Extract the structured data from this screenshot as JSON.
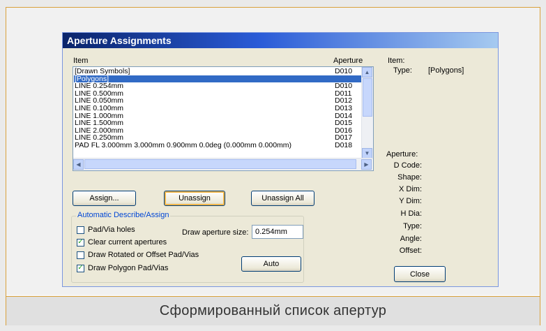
{
  "caption": "Сформированный список апертур",
  "dialog": {
    "title": "Aperture Assignments",
    "list": {
      "col_item": "Item",
      "col_aperture": "Aperture",
      "rows": [
        {
          "item": "[Drawn Symbols]",
          "aperture": "D010",
          "selected": false
        },
        {
          "item": "[Polygons]",
          "aperture": "",
          "selected": true
        },
        {
          "item": "LINE 0.254mm",
          "aperture": "D010",
          "selected": false
        },
        {
          "item": "LINE 0.500mm",
          "aperture": "D011",
          "selected": false
        },
        {
          "item": "LINE 0.050mm",
          "aperture": "D012",
          "selected": false
        },
        {
          "item": "LINE 0.100mm",
          "aperture": "D013",
          "selected": false
        },
        {
          "item": "LINE 1.000mm",
          "aperture": "D014",
          "selected": false
        },
        {
          "item": "LINE 1.500mm",
          "aperture": "D015",
          "selected": false
        },
        {
          "item": "LINE 2.000mm",
          "aperture": "D016",
          "selected": false
        },
        {
          "item": "LINE 0.250mm",
          "aperture": "D017",
          "selected": false
        },
        {
          "item": "PAD FL 3.000mm 3.000mm 0.900mm 0.0deg (0.000mm 0.000mm)",
          "aperture": "D018",
          "selected": false
        }
      ]
    },
    "item_info": {
      "label": "Item:",
      "type_label": "Type:",
      "type_value": "[Polygons]"
    },
    "aperture_info": {
      "label": "Aperture:",
      "fields": [
        "D Code:",
        "Shape:",
        "X Dim:",
        "Y Dim:",
        "H Dia:",
        "Type:",
        "Angle:",
        "Offset:"
      ]
    },
    "buttons": {
      "assign": "Assign...",
      "unassign": "Unassign",
      "unassign_all": "Unassign All",
      "auto": "Auto",
      "close": "Close"
    },
    "auto_describe": {
      "label": "Automatic Describe/Assign",
      "pad_via_holes": {
        "label": "Pad/Via holes",
        "checked": false
      },
      "clear_current": {
        "label": "Clear current apertures",
        "checked": true
      },
      "draw_rotated": {
        "label": "Draw Rotated or Offset Pad/Vias",
        "checked": false
      },
      "draw_polygon": {
        "label": "Draw Polygon Pad/Vias",
        "checked": true
      },
      "draw_size_label": "Draw aperture size:",
      "draw_size_value": "0.254mm"
    }
  }
}
